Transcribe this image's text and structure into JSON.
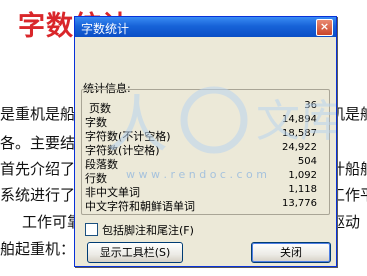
{
  "document": {
    "heading": "字数统计",
    "lines": [
      "是重机是船",
      "各。主要结构",
      "首先介绍了船",
      "系统进行了",
      "工作可靠，",
      "舶起重机："
    ],
    "right_fragments": [
      "机是船",
      "计船舶",
      "工作平",
      "驱动"
    ]
  },
  "watermark": {
    "left_glyph": "人",
    "right_glyph": "文库",
    "url": "w w w . r e n d o c . c o m"
  },
  "dialog": {
    "title": "字数统计",
    "close_glyph": "×",
    "group_label": "统计信息:",
    "stats": [
      {
        "label": "页数",
        "value": "36"
      },
      {
        "label": "字数",
        "value": "14,894"
      },
      {
        "label": "字符数(不计空格)",
        "value": "18,587"
      },
      {
        "label": "字符数(计空格)",
        "value": "24,922"
      },
      {
        "label": "段落数",
        "value": "504"
      },
      {
        "label": "行数",
        "value": "1,092"
      },
      {
        "label": "非中文单词",
        "value": "1,118"
      },
      {
        "label": "中文字符和朝鲜语单词",
        "value": "13,776"
      }
    ],
    "checkbox_label": "包括脚注和尾注(F)",
    "checkbox_checked": false,
    "toolbar_button": "显示工具栏(S)",
    "close_button": "关闭"
  }
}
